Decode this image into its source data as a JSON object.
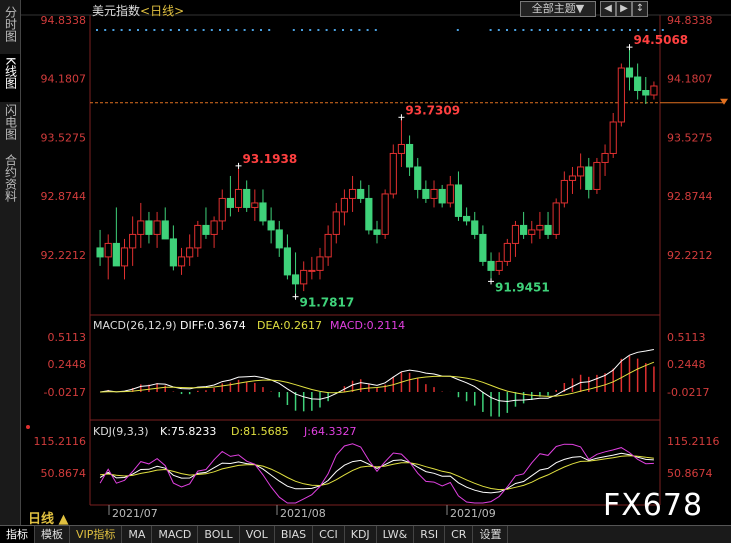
{
  "sidebar": {
    "items": [
      {
        "label": "分时图",
        "active": false
      },
      {
        "label": "K线图",
        "active": true
      },
      {
        "label": "闪电图",
        "active": false
      },
      {
        "label": "合约资料",
        "active": false
      }
    ]
  },
  "header": {
    "instrument": "美元指数",
    "period_tag": "<日线>",
    "theme_button": "全部主题▼",
    "nav_buttons": [
      "◀",
      "▶",
      "↕"
    ]
  },
  "price_axis": {
    "ticks": [
      "94.8338",
      "94.1807",
      "93.5275",
      "92.8744",
      "92.2212"
    ],
    "current_marker": "94.18"
  },
  "annotations": {
    "high1": "93.1938",
    "low1": "91.7817",
    "high2": "93.7309",
    "low2": "91.9451",
    "high3": "94.5068"
  },
  "macd": {
    "title": "MACD(26,12,9)",
    "diff": "DIFF:0.3674",
    "dea": "DEA:0.2617",
    "macd": "MACD:0.2114",
    "ticks": [
      "0.5113",
      "0.2448",
      "-0.0217"
    ]
  },
  "kdj": {
    "title": "KDJ(9,3,3)",
    "k": "K:75.8233",
    "d": "D:81.5685",
    "j": "J:64.3327",
    "ticks": [
      "115.2116",
      "50.8674"
    ]
  },
  "dates": [
    "2021/07",
    "2021/08",
    "2021/09"
  ],
  "period_label": "日线 ▲",
  "watermark": "FX678",
  "bottom_tabs": [
    {
      "label": "指标",
      "active": true
    },
    {
      "label": "模板"
    },
    {
      "label": "VIP指标",
      "vip": true
    },
    {
      "label": "MA"
    },
    {
      "label": "MACD"
    },
    {
      "label": "BOLL"
    },
    {
      "label": "VOL"
    },
    {
      "label": "BIAS"
    },
    {
      "label": "CCI"
    },
    {
      "label": "KDJ"
    },
    {
      "label": "LW&"
    },
    {
      "label": "RSI"
    },
    {
      "label": "CR"
    },
    {
      "label": "设置"
    }
  ],
  "colors": {
    "up": "#e03030",
    "down": "#3fd27a",
    "diff_line": "#ffffff",
    "dea_line": "#e0e040",
    "macd_color": "#e040e0",
    "k_line": "#ffffff",
    "d_line": "#e0e040",
    "j_line": "#e040e0",
    "axis": "#d23c3c"
  },
  "chart_data": {
    "type": "candlestick",
    "y_range": [
      91.7817,
      94.8338
    ],
    "candles": [
      {
        "o": 92.3,
        "h": 92.5,
        "l": 92.1,
        "c": 92.2
      },
      {
        "o": 92.2,
        "h": 92.45,
        "l": 91.95,
        "c": 92.35
      },
      {
        "o": 92.35,
        "h": 92.75,
        "l": 92.2,
        "c": 92.1
      },
      {
        "o": 92.1,
        "h": 92.4,
        "l": 91.95,
        "c": 92.3
      },
      {
        "o": 92.3,
        "h": 92.65,
        "l": 92.1,
        "c": 92.45
      },
      {
        "o": 92.45,
        "h": 92.8,
        "l": 92.3,
        "c": 92.6
      },
      {
        "o": 92.6,
        "h": 92.7,
        "l": 92.35,
        "c": 92.45
      },
      {
        "o": 92.45,
        "h": 92.7,
        "l": 92.3,
        "c": 92.6
      },
      {
        "o": 92.6,
        "h": 92.75,
        "l": 92.4,
        "c": 92.4
      },
      {
        "o": 92.4,
        "h": 92.55,
        "l": 92.05,
        "c": 92.1
      },
      {
        "o": 92.1,
        "h": 92.3,
        "l": 92.0,
        "c": 92.2
      },
      {
        "o": 92.2,
        "h": 92.45,
        "l": 92.1,
        "c": 92.3
      },
      {
        "o": 92.3,
        "h": 92.6,
        "l": 92.2,
        "c": 92.55
      },
      {
        "o": 92.55,
        "h": 92.75,
        "l": 92.4,
        "c": 92.45
      },
      {
        "o": 92.45,
        "h": 92.65,
        "l": 92.3,
        "c": 92.6
      },
      {
        "o": 92.6,
        "h": 92.95,
        "l": 92.5,
        "c": 92.85
      },
      {
        "o": 92.85,
        "h": 93.1,
        "l": 92.65,
        "c": 92.75
      },
      {
        "o": 92.75,
        "h": 93.19,
        "l": 92.7,
        "c": 92.95
      },
      {
        "o": 92.95,
        "h": 93.05,
        "l": 92.7,
        "c": 92.75
      },
      {
        "o": 92.75,
        "h": 92.95,
        "l": 92.6,
        "c": 92.8
      },
      {
        "o": 92.8,
        "h": 92.95,
        "l": 92.55,
        "c": 92.6
      },
      {
        "o": 92.6,
        "h": 92.75,
        "l": 92.35,
        "c": 92.5
      },
      {
        "o": 92.5,
        "h": 92.6,
        "l": 92.2,
        "c": 92.3
      },
      {
        "o": 92.3,
        "h": 92.45,
        "l": 91.95,
        "c": 92.0
      },
      {
        "o": 92.0,
        "h": 92.25,
        "l": 91.78,
        "c": 91.9
      },
      {
        "o": 91.9,
        "h": 92.15,
        "l": 91.82,
        "c": 92.05
      },
      {
        "o": 92.05,
        "h": 92.2,
        "l": 91.95,
        "c": 92.05
      },
      {
        "o": 92.05,
        "h": 92.3,
        "l": 91.95,
        "c": 92.2
      },
      {
        "o": 92.2,
        "h": 92.55,
        "l": 92.1,
        "c": 92.45
      },
      {
        "o": 92.45,
        "h": 92.8,
        "l": 92.35,
        "c": 92.7
      },
      {
        "o": 92.7,
        "h": 92.95,
        "l": 92.55,
        "c": 92.85
      },
      {
        "o": 92.85,
        "h": 93.1,
        "l": 92.7,
        "c": 92.95
      },
      {
        "o": 92.95,
        "h": 93.05,
        "l": 92.8,
        "c": 92.85
      },
      {
        "o": 92.85,
        "h": 93.0,
        "l": 92.45,
        "c": 92.5
      },
      {
        "o": 92.5,
        "h": 92.6,
        "l": 92.35,
        "c": 92.45
      },
      {
        "o": 92.45,
        "h": 92.95,
        "l": 92.4,
        "c": 92.9
      },
      {
        "o": 92.9,
        "h": 93.45,
        "l": 92.85,
        "c": 93.35
      },
      {
        "o": 93.35,
        "h": 93.73,
        "l": 93.2,
        "c": 93.45
      },
      {
        "o": 93.45,
        "h": 93.55,
        "l": 93.1,
        "c": 93.2
      },
      {
        "o": 93.2,
        "h": 93.3,
        "l": 92.85,
        "c": 92.95
      },
      {
        "o": 92.95,
        "h": 93.05,
        "l": 92.8,
        "c": 92.85
      },
      {
        "o": 92.85,
        "h": 93.05,
        "l": 92.75,
        "c": 92.95
      },
      {
        "o": 92.95,
        "h": 93.0,
        "l": 92.75,
        "c": 92.8
      },
      {
        "o": 92.8,
        "h": 93.1,
        "l": 92.75,
        "c": 93.0
      },
      {
        "o": 93.0,
        "h": 93.15,
        "l": 92.6,
        "c": 92.65
      },
      {
        "o": 92.65,
        "h": 92.75,
        "l": 92.55,
        "c": 92.6
      },
      {
        "o": 92.6,
        "h": 92.7,
        "l": 92.4,
        "c": 92.45
      },
      {
        "o": 92.45,
        "h": 92.55,
        "l": 92.1,
        "c": 92.15
      },
      {
        "o": 92.15,
        "h": 92.25,
        "l": 91.95,
        "c": 92.05
      },
      {
        "o": 92.05,
        "h": 92.25,
        "l": 92.0,
        "c": 92.15
      },
      {
        "o": 92.15,
        "h": 92.4,
        "l": 92.1,
        "c": 92.35
      },
      {
        "o": 92.35,
        "h": 92.6,
        "l": 92.2,
        "c": 92.55
      },
      {
        "o": 92.55,
        "h": 92.7,
        "l": 92.4,
        "c": 92.45
      },
      {
        "o": 92.45,
        "h": 92.6,
        "l": 92.35,
        "c": 92.5
      },
      {
        "o": 92.5,
        "h": 92.7,
        "l": 92.4,
        "c": 92.55
      },
      {
        "o": 92.55,
        "h": 92.7,
        "l": 92.4,
        "c": 92.45
      },
      {
        "o": 92.45,
        "h": 92.85,
        "l": 92.4,
        "c": 92.8
      },
      {
        "o": 92.8,
        "h": 93.15,
        "l": 92.75,
        "c": 93.05
      },
      {
        "o": 93.05,
        "h": 93.2,
        "l": 92.9,
        "c": 93.1
      },
      {
        "o": 93.1,
        "h": 93.35,
        "l": 92.95,
        "c": 93.2
      },
      {
        "o": 93.2,
        "h": 93.3,
        "l": 92.85,
        "c": 92.95
      },
      {
        "o": 92.95,
        "h": 93.3,
        "l": 92.9,
        "c": 93.25
      },
      {
        "o": 93.25,
        "h": 93.45,
        "l": 93.1,
        "c": 93.35
      },
      {
        "o": 93.35,
        "h": 93.8,
        "l": 93.3,
        "c": 93.7
      },
      {
        "o": 93.7,
        "h": 94.35,
        "l": 93.65,
        "c": 94.3
      },
      {
        "o": 94.3,
        "h": 94.51,
        "l": 94.05,
        "c": 94.2
      },
      {
        "o": 94.2,
        "h": 94.35,
        "l": 93.95,
        "c": 94.05
      },
      {
        "o": 94.05,
        "h": 94.2,
        "l": 93.9,
        "c": 94.0
      },
      {
        "o": 94.0,
        "h": 94.15,
        "l": 93.95,
        "c": 94.1
      }
    ]
  }
}
